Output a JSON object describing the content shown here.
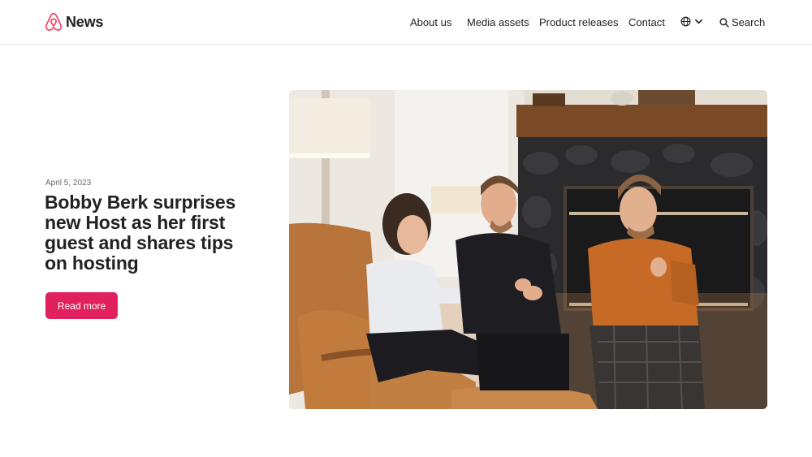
{
  "header": {
    "brand": "News",
    "nav": [
      {
        "label": "About us"
      },
      {
        "label": "Media assets"
      },
      {
        "label": "Product releases"
      },
      {
        "label": "Contact"
      }
    ],
    "search_label": "Search",
    "logo_icon": "airbnb-belo-icon",
    "globe_icon": "globe-icon",
    "chevron_icon": "chevron-down-icon",
    "search_icon": "search-icon"
  },
  "hero": {
    "date": "April 5, 2023",
    "title": "Bobby Berk surprises new Host as her first guest and shares tips on hosting",
    "cta_label": "Read more",
    "cta_color": "#e0215e",
    "brand_color": "#ff385c"
  }
}
